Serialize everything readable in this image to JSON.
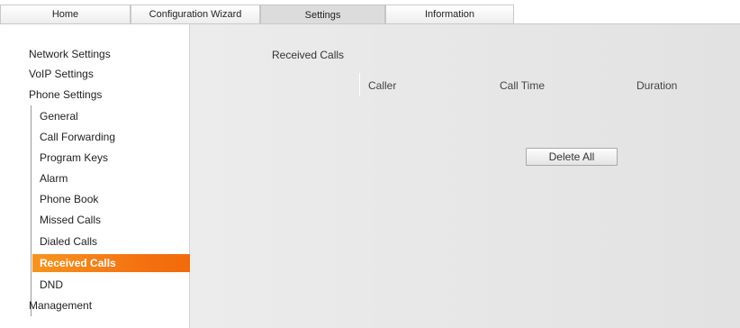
{
  "tabs": [
    {
      "label": "Home"
    },
    {
      "label": "Configuration Wizard"
    },
    {
      "label": "Settings",
      "active": true
    },
    {
      "label": "Information"
    }
  ],
  "sidebar": {
    "network": "Network Settings",
    "voip": "VoIP Settings",
    "phone": "Phone Settings",
    "phone_items": [
      {
        "label": "General"
      },
      {
        "label": "Call Forwarding"
      },
      {
        "label": "Program Keys"
      },
      {
        "label": "Alarm"
      },
      {
        "label": "Phone Book"
      },
      {
        "label": "Missed Calls"
      },
      {
        "label": "Dialed Calls"
      },
      {
        "label": "Received Calls",
        "active": true
      },
      {
        "label": "DND"
      }
    ],
    "management": "Management"
  },
  "main": {
    "title": "Received Calls",
    "columns": [
      "Caller",
      "Call Time",
      "Duration"
    ],
    "delete_all_label": "Delete All"
  },
  "colors": {
    "accent": "#f46f10"
  }
}
